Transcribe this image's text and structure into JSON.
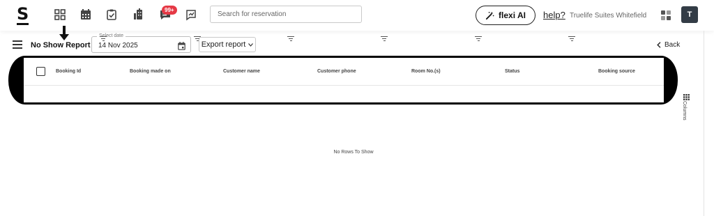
{
  "brand": {
    "logo_text": "S"
  },
  "nav": {
    "icons": [
      "dashboard-icon",
      "calendar-icon",
      "tasks-icon",
      "housekeeping-icon",
      "messages-icon",
      "reports-icon"
    ],
    "messages_badge": "99+"
  },
  "search": {
    "placeholder": "Search for reservation"
  },
  "flexi": {
    "label": "flexi AI"
  },
  "help": {
    "label": "help?"
  },
  "property": {
    "name": "Truelife Suites Whitefield"
  },
  "user": {
    "avatar_initial": "T"
  },
  "report": {
    "title": "No Show Report",
    "date_label": "Select date",
    "date_value": "14 Nov 2025",
    "export_label": "Export report",
    "back_label": "Back"
  },
  "table": {
    "columns": [
      "Booking Id",
      "Booking made on",
      "Customer name",
      "Customer phone",
      "Room No.(s)",
      "Status",
      "Booking source"
    ],
    "empty_message": "No Rows To Show",
    "columns_panel_label": "Columns"
  },
  "colors": {
    "accent_dark": "#333c46",
    "badge": "#e53945",
    "border": "#c9c9c9"
  }
}
